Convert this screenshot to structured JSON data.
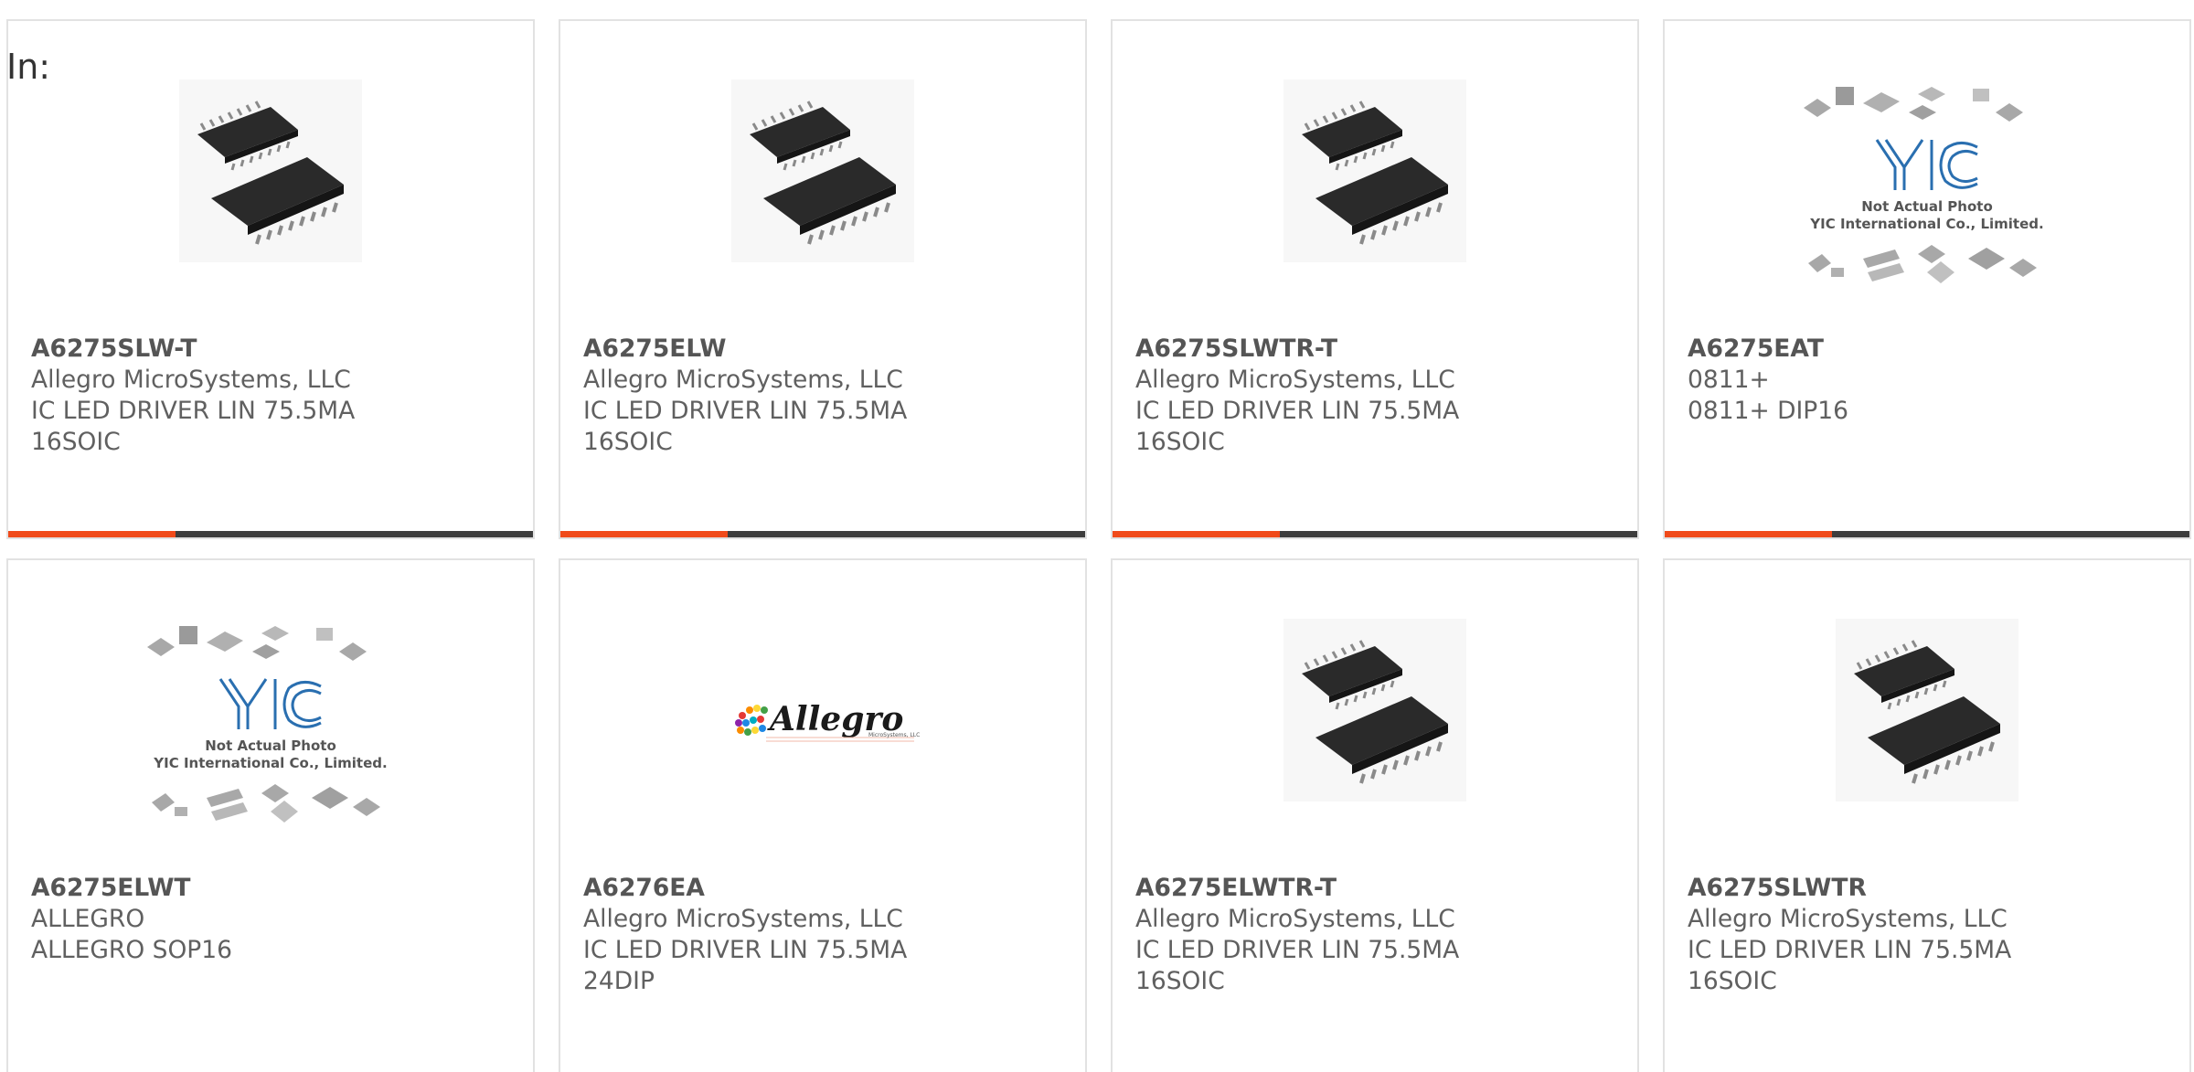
{
  "page": {
    "in_label": "In:"
  },
  "colors": {
    "accent": "#f04a1a",
    "bar_dark": "#3d3d3d",
    "card_border": "#e2e2e2",
    "text": "#606060"
  },
  "products": [
    {
      "part_number": "A6275SLW-T",
      "manufacturer": "Allegro MicroSystems, LLC",
      "description": "IC LED DRIVER LIN 75.5MA",
      "package": "16SOIC",
      "image": "soic-chip-photo"
    },
    {
      "part_number": "A6275ELW",
      "manufacturer": "Allegro MicroSystems, LLC",
      "description": "IC LED DRIVER LIN 75.5MA",
      "package": "16SOIC",
      "image": "soic-chip-photo"
    },
    {
      "part_number": "A6275SLWTR-T",
      "manufacturer": "Allegro MicroSystems, LLC",
      "description": "IC LED DRIVER LIN 75.5MA",
      "package": "16SOIC",
      "image": "soic-chip-photo"
    },
    {
      "part_number": "A6275EAT",
      "manufacturer": "0811+",
      "description": "0811+ DIP16",
      "package": "",
      "image": "yic-placeholder",
      "placeholder_text_1": "Not Actual Photo",
      "placeholder_text_2": "YIC International Co., Limited."
    },
    {
      "part_number": "A6275ELWT",
      "manufacturer": "ALLEGRO",
      "description": "ALLEGRO SOP16",
      "package": "",
      "image": "yic-placeholder",
      "placeholder_text_1": "Not Actual Photo",
      "placeholder_text_2": "YIC International Co., Limited."
    },
    {
      "part_number": "A6276EA",
      "manufacturer": "Allegro MicroSystems, LLC",
      "description": "IC LED DRIVER LIN 75.5MA",
      "package": "24DIP",
      "image": "allegro-logo",
      "logo_text": "Allegro",
      "logo_sub": "MicroSystems, LLC"
    },
    {
      "part_number": "A6275ELWTR-T",
      "manufacturer": "Allegro MicroSystems, LLC",
      "description": "IC LED DRIVER LIN 75.5MA",
      "package": "16SOIC",
      "image": "soic-chip-photo"
    },
    {
      "part_number": "A6275SLWTR",
      "manufacturer": "Allegro MicroSystems, LLC",
      "description": "IC LED DRIVER LIN 75.5MA",
      "package": "16SOIC",
      "image": "soic-chip-photo"
    }
  ]
}
